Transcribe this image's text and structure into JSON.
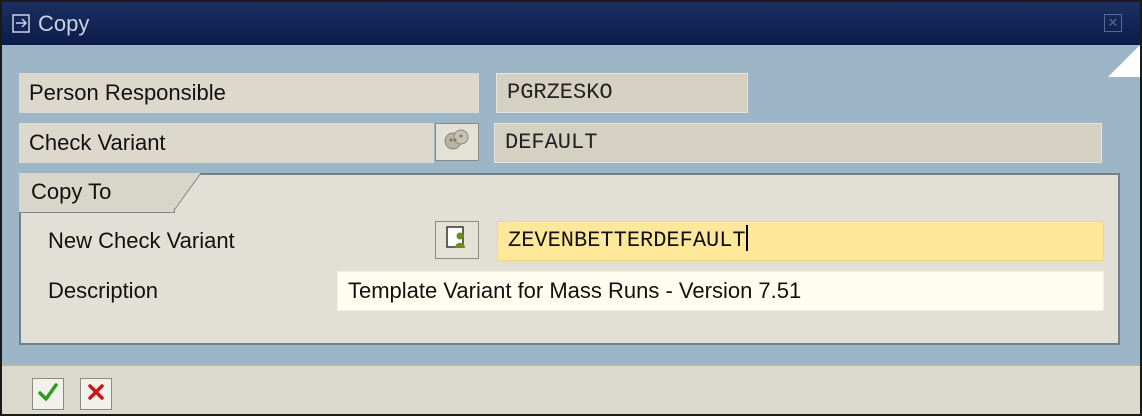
{
  "window": {
    "title": "Copy",
    "icon": "copy-window-icon",
    "close_icon": "close-icon"
  },
  "fields": {
    "person_responsible": {
      "label": "Person Responsible",
      "value": "PGRZESKO"
    },
    "check_variant": {
      "label": "Check Variant",
      "value": "DEFAULT",
      "button_icon": "variant-list-icon"
    }
  },
  "copy_to": {
    "group_title": "Copy To",
    "new_check_variant": {
      "label": "New Check Variant",
      "value": "ZEVENBETTERDEFAULT",
      "button_icon": "info-person-icon"
    },
    "description": {
      "label": "Description",
      "value": "Template Variant for Mass Runs - Version 7.51"
    }
  },
  "footer": {
    "confirm_icon": "checkmark-icon",
    "cancel_icon": "cancel-x-icon"
  },
  "colors": {
    "titlebar": "#0c1c4a",
    "background": "#9db6c7",
    "required_field": "#ffe89a",
    "confirm": "#2e9b1f",
    "cancel": "#c4181c"
  }
}
